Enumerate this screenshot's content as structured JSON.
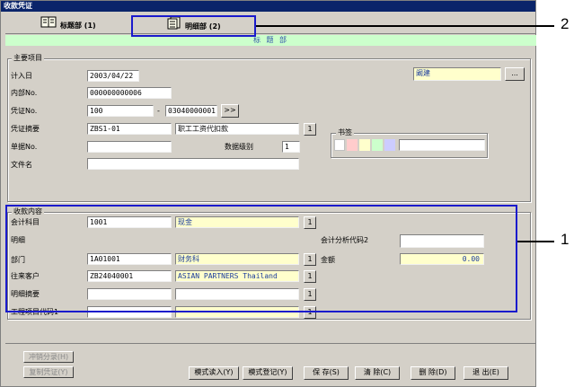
{
  "window": {
    "title": "收款凭证"
  },
  "tabs": [
    {
      "label": "标题部 (1)",
      "icon": "book-icon"
    },
    {
      "label": "明细部 (2)",
      "icon": "document-icon"
    }
  ],
  "header_band": "标 题 部",
  "main_section": {
    "legend": "主要项目",
    "date_label": "计入日",
    "date_value": "2003/04/22",
    "user_value": "阚建",
    "more_button": "...",
    "internal_no_label": "内部No.",
    "internal_no_value": "000000000006",
    "voucher_no_label": "凭证No.",
    "voucher_prefix": "100",
    "voucher_sep": "-",
    "voucher_number": "03040000001",
    "next_button": ">>",
    "summary_label": "凭证摘要",
    "summary_code": "ZBS1-01",
    "summary_text": "职工工资代扣款",
    "lookup_button": "1",
    "doc_no_label": "单据No.",
    "doc_no_value": "",
    "data_level_label": "数据级别",
    "data_level_value": "1",
    "filename_label": "文件名",
    "filename_value": "",
    "bookmark_legend": "书签",
    "bookmark_colors": [
      "#ffffff",
      "#ffcccc",
      "#ffffcc",
      "#ccffcc",
      "#ccccff"
    ]
  },
  "detail_section": {
    "legend": "收款内容",
    "account_label": "会计科目",
    "account_code": "1001",
    "account_name": "现金",
    "detail_label": "明细",
    "analysis_label": "会计分析代码2",
    "analysis_value": "",
    "dept_label": "部门",
    "dept_code": "1A01001",
    "dept_name": "财务科",
    "amount_label": "金额",
    "amount_value": "0.00",
    "customer_label": "往来客户",
    "customer_code": "ZB24040001",
    "customer_name": "ASIAN PARTNERS Thailand",
    "detail_summary_label": "明细摘要",
    "detail_summary_code": "",
    "detail_summary_text": "",
    "project_label": "工程项目代码1",
    "project_code": "",
    "project_name": "",
    "lookup_button": "1"
  },
  "footer": {
    "reverse_button": "冲销分录(H)",
    "copy_button": "复制凭证(Y)",
    "load_pattern_button": "模式读入(Y)",
    "save_pattern_button": "模式登记(Y)",
    "save_button": "保 存(S)",
    "clear_button": "清 除(C)",
    "delete_button": "删 除(D)",
    "exit_button": "退 出(E)"
  },
  "callouts": {
    "one": "1",
    "two": "2"
  },
  "colors": {
    "title_bar": "#0a246a",
    "band": "#ccffcc",
    "highlight_box": "#1a1acc",
    "yellow_field": "#ffffcc"
  }
}
